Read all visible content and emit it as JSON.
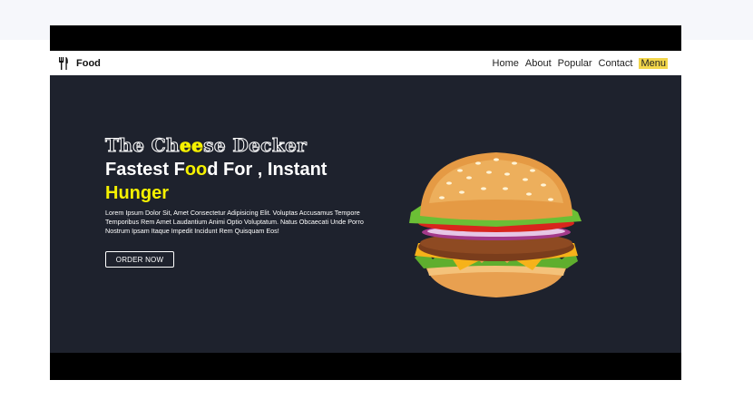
{
  "navbar": {
    "brand_name": "Food",
    "brand_icon": "fork-knife-icon",
    "links": [
      {
        "label": "Home"
      },
      {
        "label": "About"
      },
      {
        "label": "Popular"
      },
      {
        "label": "Contact"
      },
      {
        "label": "Menu",
        "active": true
      }
    ]
  },
  "hero": {
    "title_part1": "The Ch",
    "title_highlight": "ee",
    "title_part2": "se Decker",
    "headline_part1": "Fastest F",
    "headline_highlight": "oo",
    "headline_part2": "d For , Instant",
    "headline_line2": "Hunger",
    "description": "Lorem Ipsum Dolor Sit, Amet Consectetur Adipisicing Elit. Voluptas Accusamus Tempore Temporibus Rem Amet Laudantium Animi Optio Voluptatum. Natus Obcaecati Unde Porro Nostrum Ipsam Itaque Impedit Incidunt Rem Quisquam Eos!",
    "cta_label": "ORDER NOW",
    "image": "burger-image"
  },
  "colors": {
    "hero_background": "#1e222d",
    "accent_yellow": "#f5f100",
    "active_nav_bg": "#f2d64b"
  }
}
